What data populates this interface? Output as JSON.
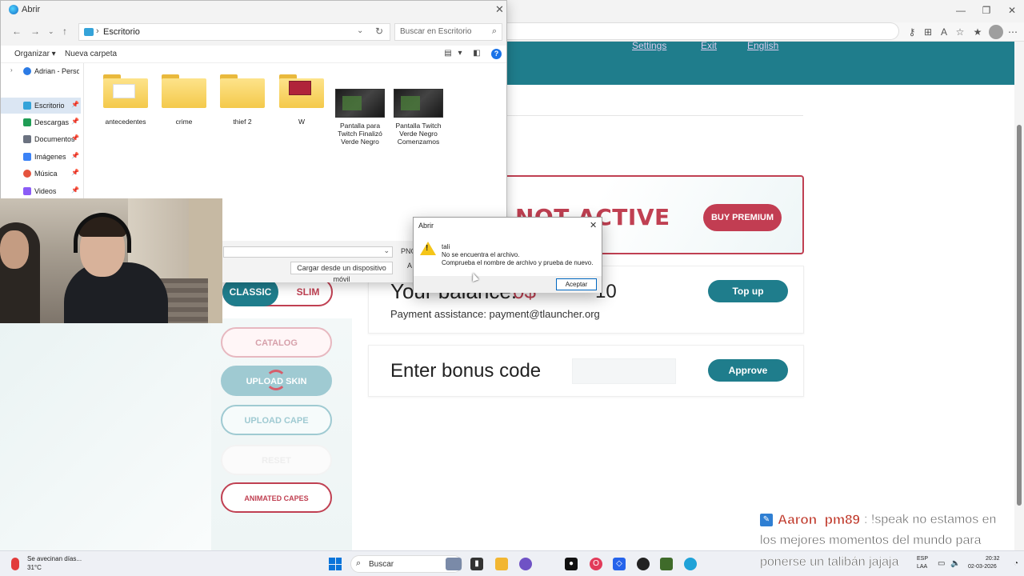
{
  "file_dialog": {
    "title": "Abrir",
    "breadcrumb": "Escritorio",
    "search_placeholder": "Buscar en Escritorio",
    "organize_label": "Organizar ▾",
    "new_folder_label": "Nueva carpeta",
    "sidebar": [
      {
        "label": "Adrian - Person",
        "icon": "cloud-icon"
      },
      {
        "label": "Escritorio",
        "icon": "desktop-icon",
        "active": true
      },
      {
        "label": "Descargas",
        "icon": "downloads-icon"
      },
      {
        "label": "Documentos",
        "icon": "documents-icon"
      },
      {
        "label": "Imágenes",
        "icon": "pictures-icon"
      },
      {
        "label": "Música",
        "icon": "music-icon"
      },
      {
        "label": "Videos",
        "icon": "videos-icon"
      }
    ],
    "files": [
      {
        "name": "antecedentes",
        "type": "folder"
      },
      {
        "name": "crime",
        "type": "folder"
      },
      {
        "name": "thief 2",
        "type": "folder"
      },
      {
        "name": "W",
        "type": "folder"
      },
      {
        "name": "Pantalla para Twitch Finalizó Verde Negro",
        "line1": "Pantalla para",
        "line2": "Twitch Finalizó",
        "line3": "Verde Negro",
        "type": "image"
      },
      {
        "name": "Pantalla Twitch Verde Negro Comenzamos",
        "line1": "Pantalla Twitch",
        "line2": "Verde Negro",
        "line3": "Comenzamos",
        "type": "image"
      }
    ],
    "file_type": "PNG",
    "load_device_label": "Cargar desde un dispositivo móvil",
    "partial_button": "A"
  },
  "error_dialog": {
    "title": "Abrir",
    "filename": "tali",
    "line1": "No se encuentra el archivo.",
    "line2": "Comprueba el nombre de archivo y prueba de nuevo.",
    "ok_label": "Aceptar"
  },
  "page": {
    "header_links": [
      "Settings",
      "Exit",
      "English"
    ],
    "premium_status": "NOT ACTIVE",
    "buy_premium_label": "BUY PREMIUM",
    "balance_title": "Your balance:",
    "balance_currency": "0$",
    "balance_amount": "10",
    "payment_assistance": "Payment assistance: payment@tlauncher.org",
    "topup_label": "Top up",
    "bonus_title": "Enter bonus code",
    "approve_label": "Approve",
    "skin_type_on": "CLASSIC",
    "skin_type_off": "SLIM",
    "catalog_label": "CATALOG",
    "upload_skin_label": "UPLOAD SKIN",
    "upload_cape_label": "UPLOAD CAPE",
    "reset_label": "RESET",
    "animated_capes_label": "ANIMATED CAPES"
  },
  "taskbar": {
    "weather_line1": "Se avecinan días...",
    "weather_line2": "31°C",
    "search_label": "Buscar",
    "lang_line1": "ESP",
    "lang_line2": "LAA",
    "time": "20:32",
    "date": "02-03-2026"
  },
  "chat": {
    "user": "Aaron_pm89",
    "line1": ": !speak no estamos en",
    "line2": "los mejores momentos del mundo para",
    "line3": "ponerse un talibán jajaja"
  },
  "colors": {
    "brand_teal": "#1f7d8c",
    "brand_red": "#c04052"
  }
}
